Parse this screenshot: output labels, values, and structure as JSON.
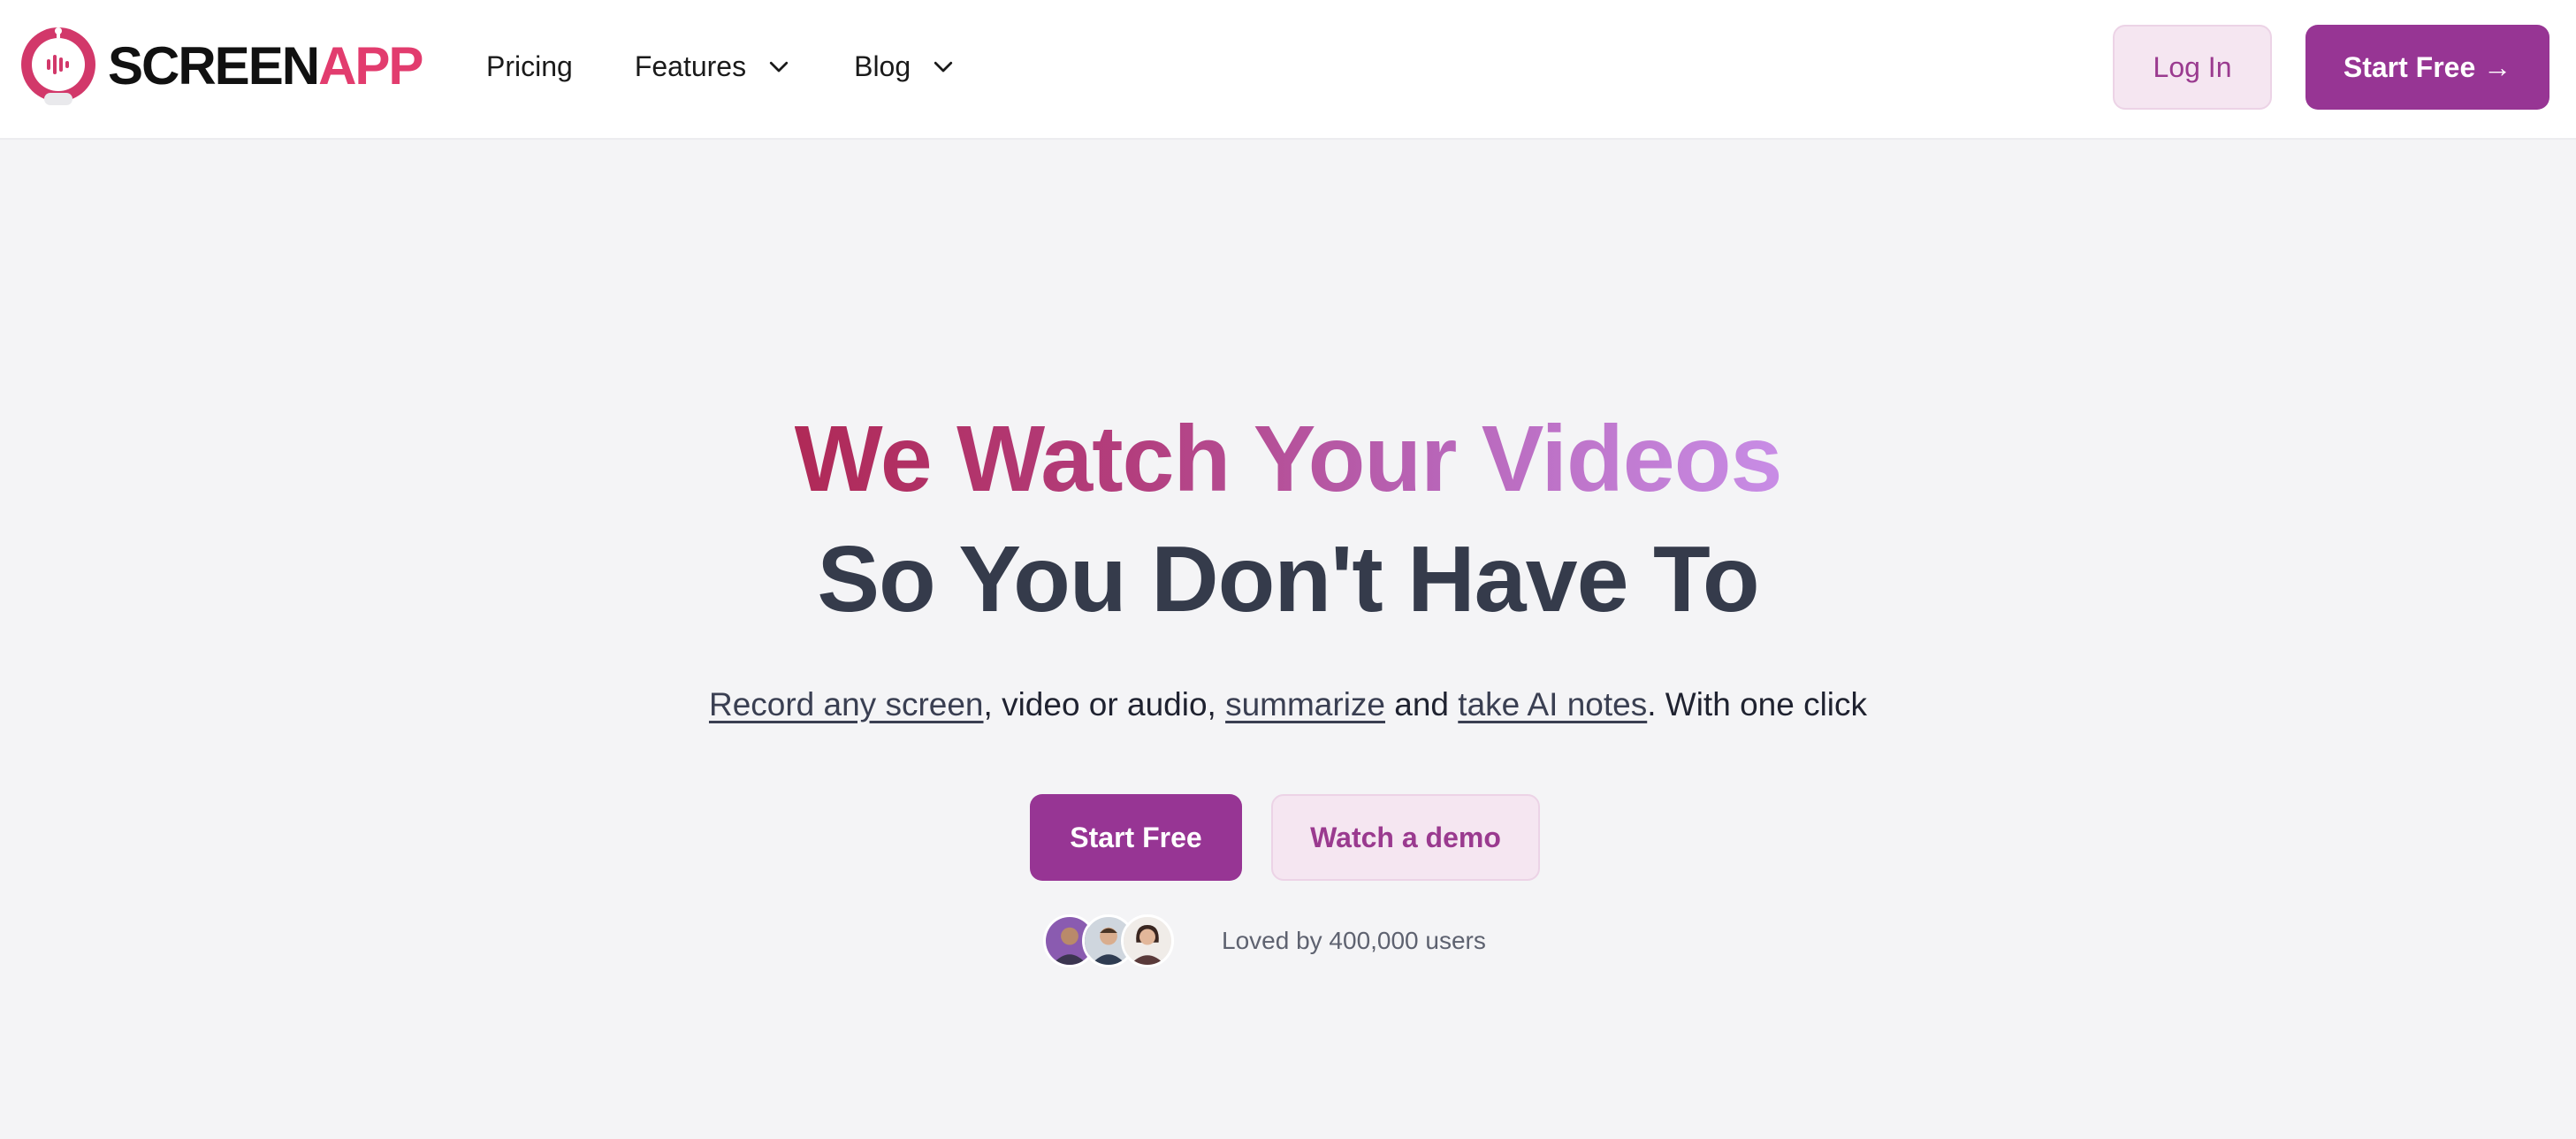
{
  "brand": {
    "name_part1": "SCREEN",
    "name_part2": "APP",
    "accent_color": "#e23c6e",
    "primary_color": "#973594"
  },
  "nav": {
    "items": [
      {
        "label": "Pricing",
        "has_dropdown": false
      },
      {
        "label": "Features",
        "has_dropdown": true
      },
      {
        "label": "Blog",
        "has_dropdown": true
      }
    ],
    "login_label": "Log In",
    "start_free_label": "Start Free →"
  },
  "hero": {
    "title_line1": "We Watch Your Videos",
    "title_line2": "So You Don't Have To",
    "subtitle": {
      "link1": "Record any screen",
      "text1": ", video or audio, ",
      "link2": "summarize",
      "text2": " and ",
      "link3": "take AI notes",
      "text3": ". With one click"
    },
    "primary_cta": "Start Free",
    "secondary_cta": "Watch a demo",
    "social_proof": "Loved by 400,000 users"
  },
  "icons": [
    "robot-logo-icon",
    "chevron-down-icon",
    "user-avatar"
  ]
}
